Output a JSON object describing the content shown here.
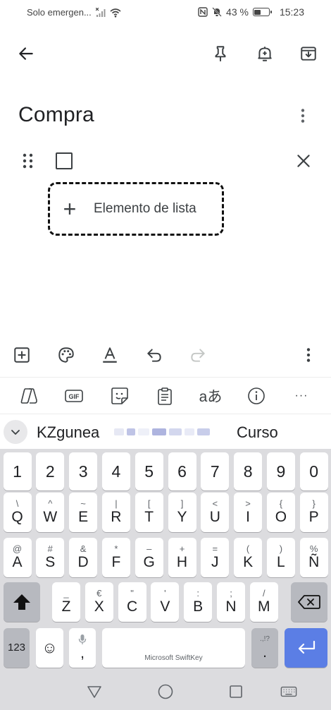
{
  "status": {
    "carrier": "Solo emergen...",
    "battery_percent": "43 %",
    "battery_level": 0.43,
    "time": "15:23"
  },
  "appbar": {
    "back_icon": "arrow-back-icon",
    "pin_icon": "pin-icon",
    "reminder_icon": "bell-plus-icon",
    "archive_icon": "archive-icon"
  },
  "note": {
    "title": "Compra",
    "add_item_label": "Elemento de lista",
    "add_item_symbol": "+"
  },
  "editor_toolbar": [
    "add-box-icon",
    "palette-icon",
    "text-format-icon",
    "undo-icon",
    "redo-icon",
    "more-vert-icon"
  ],
  "keyboard_strip": {
    "gif_label": "GIF",
    "translate_label": "aあ",
    "more_label": "···"
  },
  "suggestions": {
    "left": "KZgunea",
    "right": "Curso"
  },
  "keyboard": {
    "number_row": [
      "1",
      "2",
      "3",
      "4",
      "5",
      "6",
      "7",
      "8",
      "9",
      "0"
    ],
    "row1": [
      {
        "sec": "\\",
        "pri": "Q"
      },
      {
        "sec": "^",
        "pri": "W"
      },
      {
        "sec": "~",
        "pri": "E"
      },
      {
        "sec": "|",
        "pri": "R"
      },
      {
        "sec": "[",
        "pri": "T"
      },
      {
        "sec": "]",
        "pri": "Y"
      },
      {
        "sec": "<",
        "pri": "U"
      },
      {
        "sec": ">",
        "pri": "I"
      },
      {
        "sec": "{",
        "pri": "O"
      },
      {
        "sec": "}",
        "pri": "P"
      }
    ],
    "row2": [
      {
        "sec": "@",
        "pri": "A"
      },
      {
        "sec": "#",
        "pri": "S"
      },
      {
        "sec": "&",
        "pri": "D"
      },
      {
        "sec": "*",
        "pri": "F"
      },
      {
        "sec": "–",
        "pri": "G"
      },
      {
        "sec": "+",
        "pri": "H"
      },
      {
        "sec": "=",
        "pri": "J"
      },
      {
        "sec": "(",
        "pri": "K"
      },
      {
        "sec": ")",
        "pri": "L"
      },
      {
        "sec": "%",
        "pri": "Ñ"
      }
    ],
    "row3": [
      {
        "sec": "_",
        "pri": "Z"
      },
      {
        "sec": "€",
        "pri": "X"
      },
      {
        "sec": "\"",
        "pri": "C"
      },
      {
        "sec": "'",
        "pri": "V"
      },
      {
        "sec": ":",
        "pri": "B"
      },
      {
        "sec": ";",
        "pri": "N"
      },
      {
        "sec": "/",
        "pri": "M"
      }
    ],
    "numbers_label": "123",
    "emoji_label": "☺",
    "comma_label": ",",
    "space_label": "Microsoft SwiftKey",
    "period_sec": ".,!?",
    "period_label": "."
  }
}
